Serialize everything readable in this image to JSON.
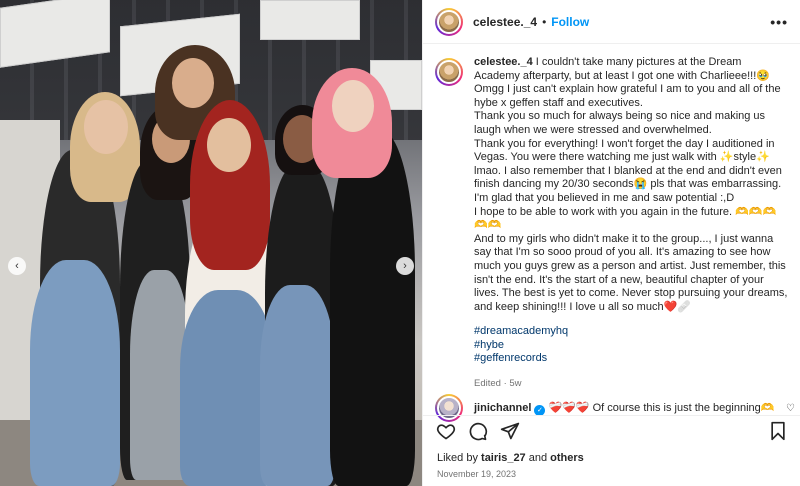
{
  "post": {
    "username": "celestee._4",
    "separator": "•",
    "follow_label": "Follow",
    "more_label": "•••"
  },
  "caption": {
    "username": "celestee._4",
    "text": " I couldn't take many pictures at the Dream Academy afterparty, but at least I got one with Charlieee!!!🥹 Omgg I just can't explain how grateful I am to you and all of the hybe x geffen staff and executives.\nThank you so much for always being so nice and making us laugh when we were stressed and overwhelmed.\nThank you for everything! I won't forget the day I auditioned in Vegas. You were there watching me just walk with ✨style✨ lmao. I also remember that I blanked at the end and didn't even finish dancing my 20/30 seconds😭 pls that was embarrassing. I'm glad that you believed in me and saw potential :,D\nI hope to be able to work with you again in the future. 🫶🫶🫶🫶🫶\nAnd to my girls who didn't make it to the group..., I just wanna say that I'm so sooo proud of you all. It's amazing to see how much you guys grew as a person and artist. Just remember, this isn't the end. It's the start of a new, beautiful chapter of your lives. The best is yet to come. Never stop pursuing your dreams, and keep shining!!! I love u all so much❤️🩹",
    "hashtags": [
      "#dreamacademyhq",
      "#hybe",
      "#geffenrecords"
    ],
    "edited": "Edited · 5w"
  },
  "comment": {
    "username": "jinichannel",
    "verified_mark": "✓",
    "text": "❤️‍🩹❤️‍🩹❤️‍🩹 Of course this is just the beginning🫶"
  },
  "likes": {
    "prefix": "Liked by ",
    "user": "tairis_27",
    "middle": " and ",
    "others": "others"
  },
  "date": "November 19, 2023",
  "icons": {
    "like": "heart-icon",
    "comment": "comment-icon",
    "share": "share-icon",
    "save": "bookmark-icon",
    "prev": "chevron-left-icon",
    "next": "chevron-right-icon"
  },
  "colors": {
    "link": "#0095f6",
    "hashtag": "#00376b",
    "muted": "#737373"
  }
}
